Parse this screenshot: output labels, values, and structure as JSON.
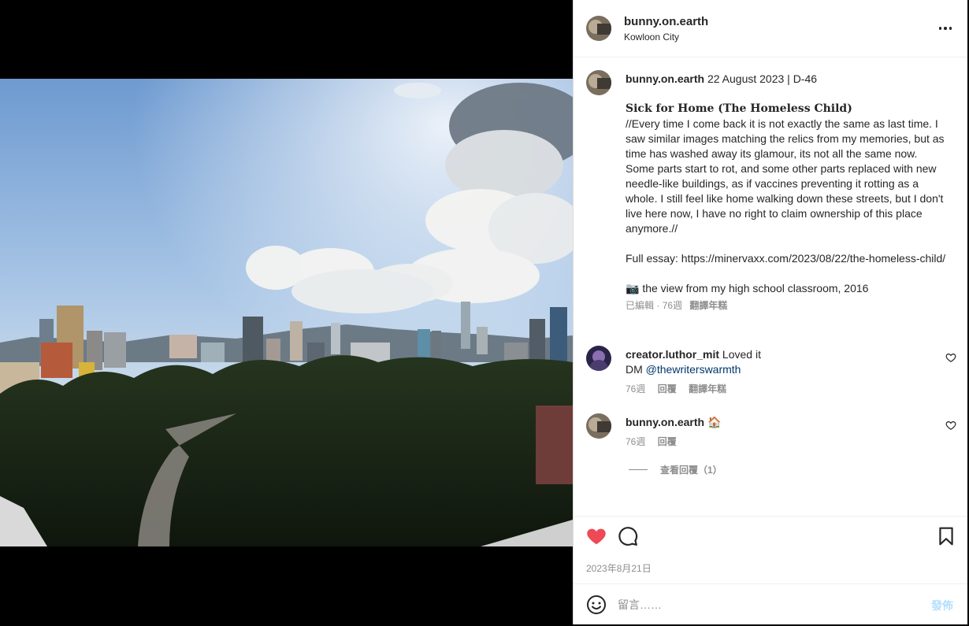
{
  "post": {
    "username": "bunny.on.earth",
    "location": "Kowloon City",
    "date": "2023年8月21日"
  },
  "caption": {
    "username": "bunny.on.earth",
    "header": "22 August 2023 | D-46",
    "title": "Sick for Home (The Homeless Child)",
    "body": "//Every time I come back it is not exactly the same as last time. I saw similar images matching the relics from my memories, but as time has washed away its glamour, its not all the same now. Some parts start to rot, and some other parts replaced with new needle-like buildings, as if vaccines preventing it rotting as a whole. I still feel like home walking down these streets, but I don't live here now, I have no right to claim ownership of this place anymore.//",
    "essay": "Full essay: https://minervaxx.com/2023/08/22/the-homeless-child/",
    "photo_note": "📷 the view from my high school classroom, 2016",
    "edited": "已編輯",
    "age": "76週",
    "translate": "翻譯年糕"
  },
  "comments": [
    {
      "username": "creator.luthor_mit",
      "text": "Loved it",
      "text2": "DM ",
      "mention": "@thewriterswarmth",
      "age": "76週",
      "reply": "回覆",
      "translate": "翻譯年糕"
    },
    {
      "username": "bunny.on.earth",
      "text": "🏠",
      "age": "76週",
      "reply": "回覆",
      "view_replies": "查看回覆（1）"
    }
  ],
  "composer": {
    "placeholder": "留言……",
    "post_label": "發佈"
  },
  "colors": {
    "like": "#ed4956",
    "link": "#00376b",
    "post_disabled": "#b2dffc"
  }
}
